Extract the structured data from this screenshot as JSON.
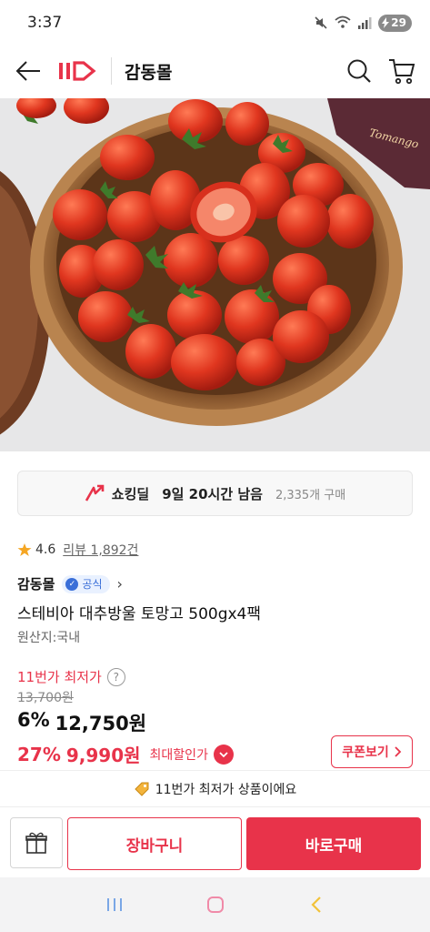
{
  "status": {
    "time": "3:37",
    "battery": "29"
  },
  "header": {
    "title": "감동몰",
    "logo": "11st-logo",
    "back_icon": "arrow-left-icon",
    "search_icon": "search-icon",
    "cart_icon": "cart-icon"
  },
  "product_image": {
    "brand_text": "Tomango"
  },
  "deal": {
    "label": "쇼킹딜",
    "time_left": "9일 20시간 남음",
    "purchase_count": "2,335개 구매"
  },
  "rating": {
    "value": "4.6",
    "review_label": "리뷰 1,892건"
  },
  "seller": {
    "name": "감동몰",
    "badge": "공식"
  },
  "product": {
    "title": "스테비아 대추방울 토망고 500gx4팩",
    "origin": "원산지:국내"
  },
  "pricing": {
    "lowest_label": "11번가 최저가",
    "original_price": "13,700원",
    "discount_pct": "6%",
    "sale_price": "12,750원",
    "max_pct": "27%",
    "max_price": "9,990원",
    "max_label": "최대할인가",
    "coupon_label": "쿠폰보기"
  },
  "notice": {
    "text": "11번가 최저가 상품이에요"
  },
  "actions": {
    "cart_label": "장바구니",
    "buy_label": "바로구매"
  },
  "colors": {
    "accent": "#e8334a",
    "badge_blue": "#3a6fd8",
    "text": "#111111",
    "muted": "#888888"
  }
}
